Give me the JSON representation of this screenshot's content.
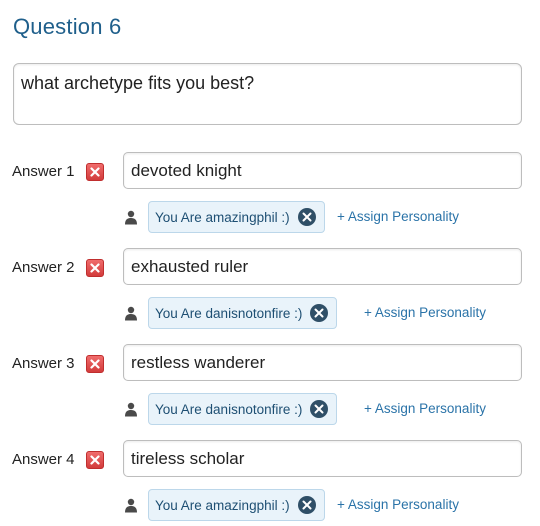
{
  "question": {
    "title": "Question 6",
    "text": "what archetype fits you best?"
  },
  "answers": [
    {
      "label": "Answer 1",
      "value": "devoted knight",
      "personality": "You Are amazingphil :)",
      "assign_label": "+ Assign Personality"
    },
    {
      "label": "Answer 2",
      "value": "exhausted ruler",
      "personality": "You Are danisnotonfire :)",
      "assign_label": "+ Assign Personality"
    },
    {
      "label": "Answer 3",
      "value": "restless wanderer",
      "personality": "You Are danisnotonfire :)",
      "assign_label": "+ Assign Personality"
    },
    {
      "label": "Answer 4",
      "value": "tireless scholar",
      "personality": "You Are amazingphil :)",
      "assign_label": "+ Assign Personality"
    }
  ],
  "icons": {
    "delete": "close-square-icon",
    "person": "person-icon",
    "chip_remove": "close-circle-icon"
  },
  "colors": {
    "title": "#1f5f8b",
    "delete_button": "#d23b3b",
    "chip_background": "#e9f3fa",
    "chip_border": "#bcd7ea",
    "link": "#2a73a8"
  }
}
